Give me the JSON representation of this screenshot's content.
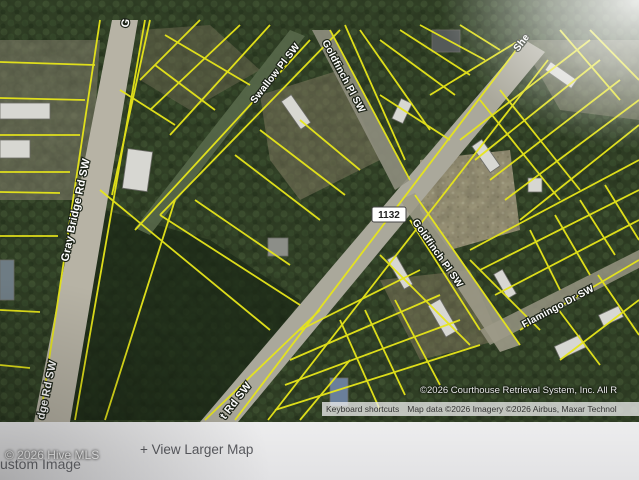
{
  "map": {
    "view": "satellite",
    "parcel_line_color": "#e7e61a",
    "road_labels": {
      "gray_bridge_main": "Gray Bridge Rd SW",
      "gray_bridge_bottom": "dge Rd SW",
      "gray_bridge_top": "G",
      "swallow": "Swallow Pl SW",
      "goldfinch_upper": "Goldfinch Pl SW",
      "goldfinch_lower": "Goldfinch Pl SW",
      "flamingo": "Flamingo Dr SW",
      "shearwater_partial": "She",
      "main_road_partial": "t Rd SW"
    },
    "route_shield": "1132",
    "attribution": {
      "copyright_line": "©2026 Courthouse Retrieval System, Inc. All R",
      "keyboard_shortcuts": "Keyboard shortcuts",
      "map_data": "Map data ©2026 Imagery ©2026 Airbus, Maxar Technol"
    }
  },
  "footer": {
    "custom_image_label": "ustom Image",
    "view_larger_map": "+ View Larger Map",
    "watermark": "© 2026 Hive MLS"
  }
}
